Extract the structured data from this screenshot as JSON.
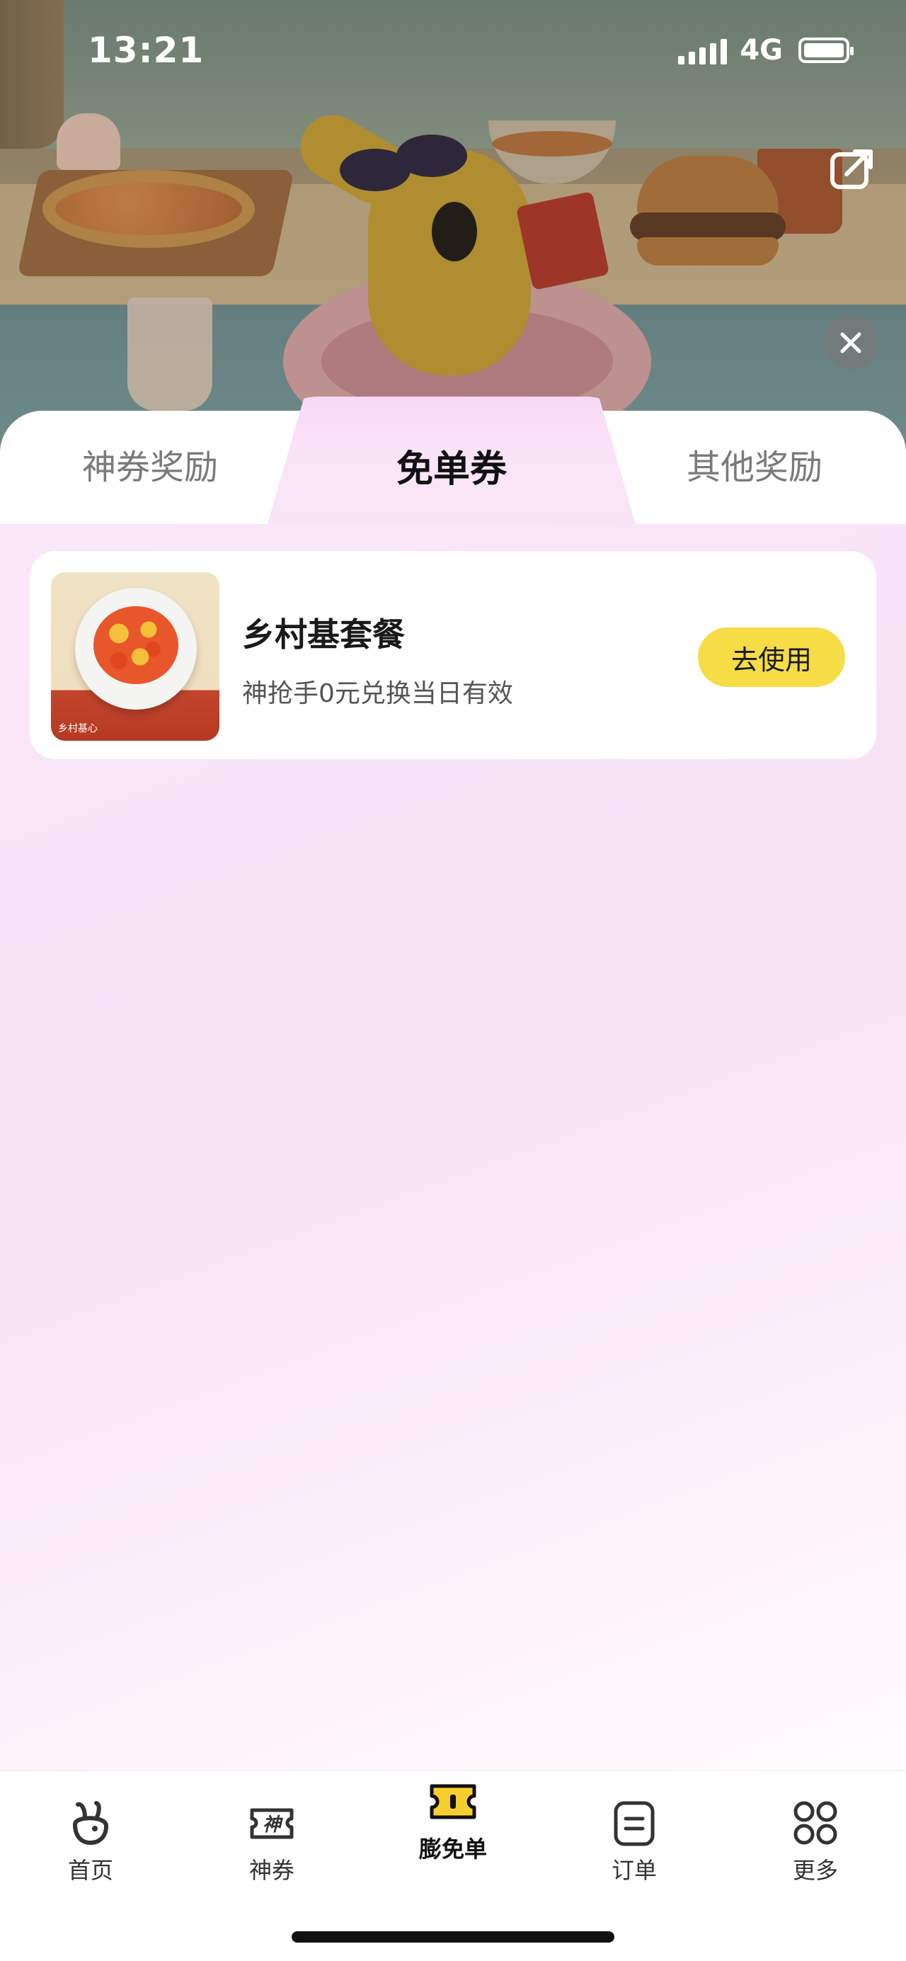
{
  "status_bar": {
    "time": "13:21",
    "network": "4G",
    "battery_level": 1.0
  },
  "header": {
    "share_icon": "share-icon",
    "close_icon": "close-icon"
  },
  "tabs": [
    {
      "label": "神券奖励",
      "active": false
    },
    {
      "label": "免单券",
      "active": true
    },
    {
      "label": "其他奖励",
      "active": false
    }
  ],
  "rewards": [
    {
      "title": "乡村基套餐",
      "description": "神抢手0元兑换当日有效",
      "button_label": "去使用",
      "image_caption": "乡村基心"
    }
  ],
  "bottom_nav": [
    {
      "label": "首页",
      "icon": "home-rabbit-icon",
      "active": false
    },
    {
      "label": "神券",
      "icon": "coupon-icon",
      "active": false
    },
    {
      "label": "膨免单",
      "icon": "ticket-icon",
      "active": true
    },
    {
      "label": "订单",
      "icon": "order-icon",
      "active": false
    },
    {
      "label": "更多",
      "icon": "grid-icon",
      "active": false
    }
  ],
  "colors": {
    "accent_yellow": "#f6dc45",
    "panel_pink": "#f9e3f8",
    "text_dark": "#1a1a1a",
    "text_muted": "#7a7a7a"
  }
}
